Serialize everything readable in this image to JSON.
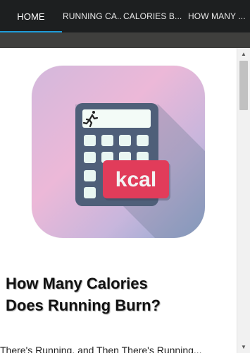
{
  "tabs": [
    {
      "label": "HOME",
      "active": true
    },
    {
      "label": "RUNNING CA..",
      "active": false
    },
    {
      "label": "CALORIES B...",
      "active": false
    },
    {
      "label": "HOW MANY ...",
      "active": false
    }
  ],
  "icon": {
    "name": "calorie-calculator-app-icon",
    "badge_text": "kcal"
  },
  "article": {
    "title": "How Many Calories Does Running Burn?",
    "body_preview": "There's Running, and Then There's Running..."
  },
  "colors": {
    "tabbar": "#1d1f20",
    "active_tab_indicator": "#1d9bd8",
    "strip": "#3f3f3d",
    "kcal_badge": "#e13c5a"
  }
}
